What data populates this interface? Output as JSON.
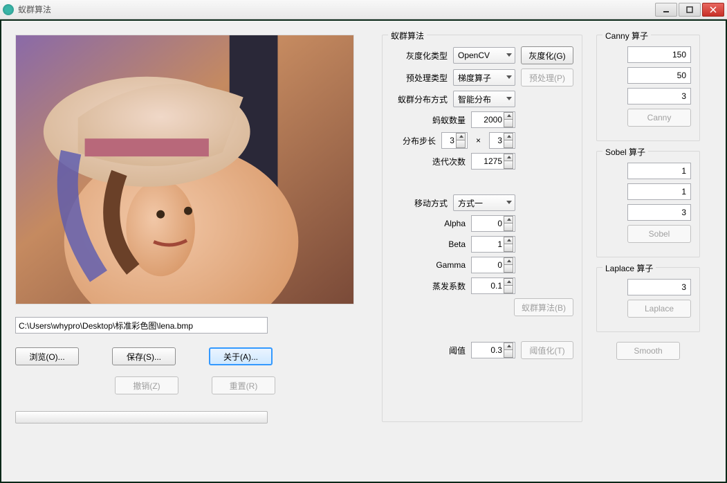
{
  "window": {
    "title": "蚁群算法"
  },
  "left": {
    "path_value": "C:\\Users\\whypro\\Desktop\\标准彩色图\\lena.bmp",
    "browse": "浏览(O)...",
    "save": "保存(S)...",
    "about": "关于(A)...",
    "undo": "撤销(Z)",
    "reset": "重置(R)"
  },
  "aco": {
    "legend": "蚁群算法",
    "gray_type_label": "灰度化类型",
    "gray_type_value": "OpenCV",
    "gray_btn": "灰度化(G)",
    "preproc_type_label": "预处理类型",
    "preproc_type_value": "梯度算子",
    "preproc_btn": "预处理(P)",
    "dist_mode_label": "蚁群分布方式",
    "dist_mode_value": "智能分布",
    "ant_count_label": "蚂蚁数量",
    "ant_count_value": "2000",
    "step_label": "分布步长",
    "step_x": "3",
    "step_y": "3",
    "iter_label": "迭代次数",
    "iter_value": "1275",
    "move_mode_label": "移动方式",
    "move_mode_value": "方式一",
    "alpha_label": "Alpha",
    "alpha_value": "0",
    "beta_label": "Beta",
    "beta_value": "1",
    "gamma_label": "Gamma",
    "gamma_value": "0",
    "evap_label": "蒸发系数",
    "evap_value": "0.1",
    "run_btn": "蚁群算法(B)",
    "thresh_label": "阈值",
    "thresh_value": "0.3",
    "thresh_btn": "阈值化(T)",
    "x_symbol": "×"
  },
  "canny": {
    "legend": "Canny 算子",
    "p1": "150",
    "p2": "50",
    "p3": "3",
    "btn": "Canny"
  },
  "sobel": {
    "legend": "Sobel 算子",
    "p1": "1",
    "p2": "1",
    "p3": "3",
    "btn": "Sobel"
  },
  "laplace": {
    "legend": "Laplace 算子",
    "p1": "3",
    "btn": "Laplace"
  },
  "smooth_btn": "Smooth"
}
